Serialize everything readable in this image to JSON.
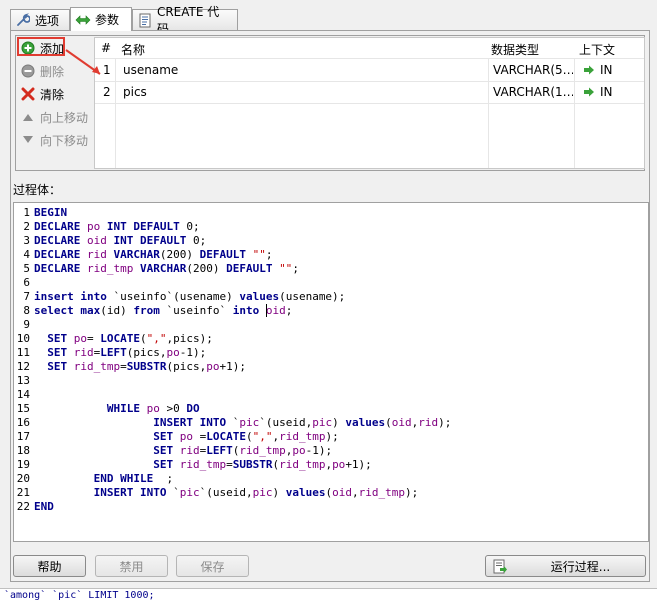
{
  "tabs": [
    {
      "label": "选项",
      "icon": "wrench-icon"
    },
    {
      "label": "参数",
      "icon": "double-arrow-icon"
    },
    {
      "label": "CREATE 代码",
      "icon": "code-document-icon"
    }
  ],
  "param_toolbar": {
    "add": "添加",
    "delete": "删除",
    "clear": "清除",
    "move_up": "向上移动",
    "move_down": "向下移动"
  },
  "param_grid": {
    "columns": [
      "#",
      "名称",
      "数据类型",
      "上下文"
    ],
    "rows": [
      {
        "num": "1",
        "name": "usename",
        "type": "VARCHAR(5…",
        "context": "IN"
      },
      {
        "num": "2",
        "name": "pics",
        "type": "VARCHAR(1…",
        "context": "IN"
      }
    ]
  },
  "body_label": "过程体：",
  "code_lines": [
    "BEGIN",
    "DECLARE po INT DEFAULT 0;",
    "DECLARE oid INT DEFAULT 0;",
    "DECLARE rid VARCHAR(200) DEFAULT \"\";",
    "DECLARE rid_tmp VARCHAR(200) DEFAULT \"\";",
    "",
    "insert into `useinfo`(usename) values(usename);",
    "select max(id) from `useinfo` into oid;",
    "",
    "  SET po= LOCATE(\",\",pics);",
    "  SET rid=LEFT(pics,po-1);",
    "  SET rid_tmp=SUBSTR(pics,po+1);",
    "",
    "",
    "           WHILE po >0 DO",
    "                  INSERT INTO `pic`(useid,pic) values(oid,rid);",
    "                  SET po =LOCATE(\",\",rid_tmp);",
    "                  SET rid=LEFT(rid_tmp,po-1);",
    "                  SET rid_tmp=SUBSTR(rid_tmp,po+1);",
    "         END WHILE  ;",
    "         INSERT INTO `pic`(useid,pic) values(oid,rid_tmp);",
    "END"
  ],
  "buttons": {
    "help": "帮助",
    "disable": "禁用",
    "save": "保存",
    "run": "运行过程..."
  },
  "status_strip": "`among` `pic` LIMIT 1000;",
  "colors": {
    "keyword": "#00008b",
    "identifier": "#800080",
    "string": "#c00000",
    "highlight": "#e03c31"
  }
}
